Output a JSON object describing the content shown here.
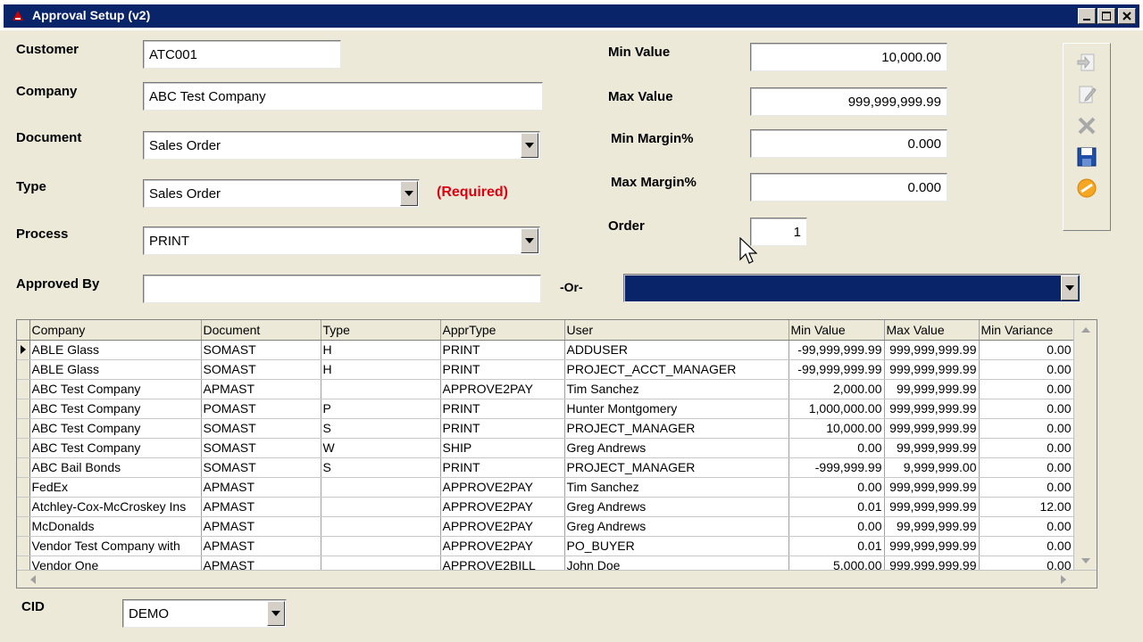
{
  "window": {
    "title": "Approval Setup (v2)"
  },
  "form": {
    "customer": {
      "label": "Customer",
      "value": "ATC001"
    },
    "company": {
      "label": "Company",
      "value": "ABC Test Company"
    },
    "document": {
      "label": "Document",
      "value": "Sales Order"
    },
    "type": {
      "label": "Type",
      "value": "Sales Order",
      "required_note": "(Required)"
    },
    "process": {
      "label": "Process",
      "value": "PRINT"
    },
    "approved_by": {
      "label": "Approved By",
      "value": "",
      "or_label": "-Or-",
      "alt_value": ""
    },
    "min_value": {
      "label": "Min Value",
      "value": "10,000.00"
    },
    "max_value": {
      "label": "Max Value",
      "value": "999,999,999.99"
    },
    "min_margin": {
      "label": "Min Margin%",
      "value": "0.000"
    },
    "max_margin": {
      "label": "Max Margin%",
      "value": "0.000"
    },
    "order": {
      "label": "Order",
      "value": "1"
    },
    "cid": {
      "label": "CID",
      "value": "DEMO"
    }
  },
  "toolbar": {
    "items": [
      "new-record-icon",
      "edit-icon",
      "delete-icon",
      "save-icon",
      "cancel-icon"
    ]
  },
  "grid": {
    "columns": [
      "Company",
      "Document",
      "Type",
      "ApprType",
      "User",
      "Min Value",
      "Max Value",
      "Min Variance"
    ],
    "rows": [
      [
        "ABLE Glass",
        "SOMAST",
        "H",
        "PRINT",
        "ADDUSER",
        "-99,999,999.99",
        "999,999,999.99",
        "0.00"
      ],
      [
        "ABLE Glass",
        "SOMAST",
        "H",
        "PRINT",
        "PROJECT_ACCT_MANAGER",
        "-99,999,999.99",
        "999,999,999.99",
        "0.00"
      ],
      [
        "ABC Test Company",
        "APMAST",
        "",
        "APPROVE2PAY",
        "Tim Sanchez",
        "2,000.00",
        "99,999,999.99",
        "0.00"
      ],
      [
        "ABC Test Company",
        "POMAST",
        "P",
        "PRINT",
        "Hunter Montgomery",
        "1,000,000.00",
        "999,999,999.99",
        "0.00"
      ],
      [
        "ABC Test Company",
        "SOMAST",
        "S",
        "PRINT",
        "PROJECT_MANAGER",
        "10,000.00",
        "999,999,999.99",
        "0.00"
      ],
      [
        "ABC Test Company",
        "SOMAST",
        "W",
        "SHIP",
        "Greg Andrews",
        "0.00",
        "99,999,999.99",
        "0.00"
      ],
      [
        "ABC Bail Bonds",
        "SOMAST",
        "S",
        "PRINT",
        "PROJECT_MANAGER",
        "-999,999.99",
        "9,999,999.00",
        "0.00"
      ],
      [
        "FedEx",
        "APMAST",
        "",
        "APPROVE2PAY",
        "Tim Sanchez",
        "0.00",
        "999,999,999.99",
        "0.00"
      ],
      [
        "Atchley-Cox-McCroskey Ins",
        "APMAST",
        "",
        "APPROVE2PAY",
        "Greg Andrews",
        "0.01",
        "999,999,999.99",
        "12.00"
      ],
      [
        "McDonalds",
        "APMAST",
        "",
        "APPROVE2PAY",
        "Greg Andrews",
        "0.00",
        "99,999,999.99",
        "0.00"
      ],
      [
        "Vendor Test Company with",
        "APMAST",
        "",
        "APPROVE2PAY",
        "PO_BUYER",
        "0.01",
        "999,999,999.99",
        "0.00"
      ],
      [
        "Vendor One",
        "APMAST",
        "",
        "APPROVE2BILL",
        "John Doe",
        "5,000.00",
        "999,999,999.99",
        "0.00"
      ]
    ]
  },
  "colors": {
    "title_bar": "#0a246a",
    "required": "#e0000f",
    "selection": "#0a246a"
  }
}
